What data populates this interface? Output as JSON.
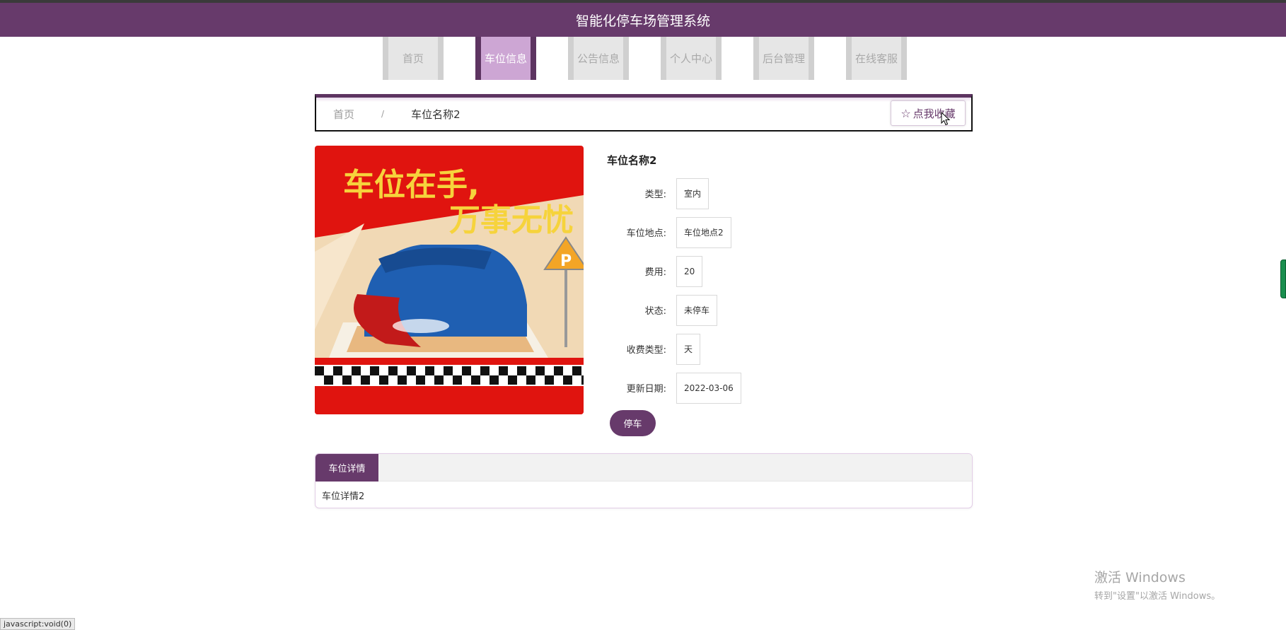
{
  "header": {
    "title": "智能化停车场管理系统"
  },
  "nav": {
    "items": [
      {
        "label": "首页"
      },
      {
        "label": "车位信息"
      },
      {
        "label": "公告信息"
      },
      {
        "label": "个人中心"
      },
      {
        "label": "后台管理"
      },
      {
        "label": "在线客服"
      }
    ],
    "active": "车位信息"
  },
  "breadcrumb": {
    "home": "首页",
    "separator": "/",
    "current": "车位名称2"
  },
  "favorite": {
    "icon": "star-outline-icon",
    "label": "点我收藏"
  },
  "product": {
    "image": {
      "headline1": "车位在手,",
      "headline2": "万事无忧"
    },
    "title": "车位名称2",
    "fields": [
      {
        "label": "类型:",
        "value": "室内"
      },
      {
        "label": "车位地点:",
        "value": "车位地点2"
      },
      {
        "label": "费用:",
        "value": "20"
      },
      {
        "label": "状态:",
        "value": "未停车"
      },
      {
        "label": "收费类型:",
        "value": "天"
      },
      {
        "label": "更新日期:",
        "value": "2022-03-06"
      }
    ],
    "park_button": "停车"
  },
  "detail": {
    "tab_label": "车位详情",
    "content": "车位详情2"
  },
  "watermark": {
    "line1": "激活 Windows",
    "line2": "转到\"设置\"以激活 Windows。"
  },
  "status_bar": {
    "url": "javascript:void(0)"
  },
  "colors": {
    "primary": "#673a6b",
    "active_nav": "#cda6d4",
    "nav_inactive": "#e6e6e6"
  }
}
